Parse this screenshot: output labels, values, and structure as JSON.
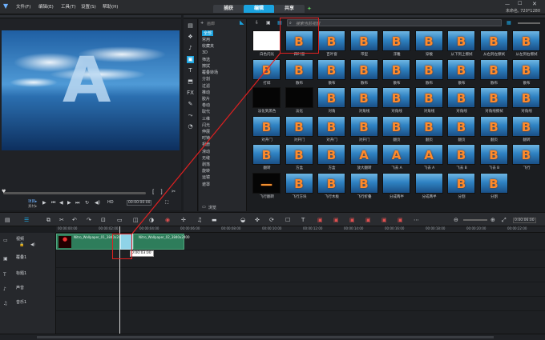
{
  "menu": {
    "items": [
      "文件(F)",
      "编辑(E)",
      "工具(T)",
      "设置(S)",
      "帮助(H)"
    ]
  },
  "modes": {
    "capture": "捕获",
    "edit": "编辑",
    "share": "共享"
  },
  "project": {
    "title": "未命名, 720*1280"
  },
  "preview": {
    "letter": "A",
    "mode_project": "项目▸",
    "mode_clip": "素材▸",
    "timecode": "00:00:00:00"
  },
  "library": {
    "search_placeholder": "搜索当前视图",
    "category_title": "画廊",
    "browse_label": "浏览",
    "categories": [
      "全部",
      "常用",
      "收藏夹",
      "3D",
      "筛选",
      "擦拭",
      "覆叠转场",
      "分割",
      "过滤",
      "推动",
      "胶片",
      "卷动",
      "取代",
      "三维",
      "闪光",
      "伸展",
      "时钟",
      "相册",
      "滑动",
      "无缝",
      "剥落",
      "旋转",
      "运镜",
      "遮罩"
    ],
    "transitions": [
      {
        "label": "白色闪光",
        "style": "white",
        "glyph": ""
      },
      {
        "label": "四叶窗",
        "style": "sky",
        "glyph": "B"
      },
      {
        "label": "百叶窗",
        "style": "sky",
        "glyph": "B"
      },
      {
        "label": "带型",
        "style": "sky",
        "glyph": "B"
      },
      {
        "label": "浮雕",
        "style": "sky",
        "glyph": "B"
      },
      {
        "label": "穿梭",
        "style": "sky",
        "glyph": "B"
      },
      {
        "label": "从下到上擦拭",
        "style": "sky",
        "glyph": "B"
      },
      {
        "label": "从右到左擦拭",
        "style": "sky",
        "glyph": "B"
      },
      {
        "label": "从左到右擦拭",
        "style": "sky",
        "glyph": "B"
      },
      {
        "label": "打碎",
        "style": "sky",
        "glyph": "B"
      },
      {
        "label": "散布",
        "style": "sky",
        "glyph": "B"
      },
      {
        "label": "散布",
        "style": "sky",
        "glyph": "B"
      },
      {
        "label": "散布",
        "style": "sky",
        "glyph": "B"
      },
      {
        "label": "散布",
        "style": "sky",
        "glyph": "B"
      },
      {
        "label": "散布",
        "style": "sky",
        "glyph": "B"
      },
      {
        "label": "散布",
        "style": "sky",
        "glyph": "B"
      },
      {
        "label": "散布",
        "style": "sky",
        "glyph": "B"
      },
      {
        "label": "散布",
        "style": "sky",
        "glyph": "B"
      },
      {
        "label": "淡化到黑色",
        "style": "black",
        "glyph": ""
      },
      {
        "label": "淡化",
        "style": "black",
        "glyph": ""
      },
      {
        "label": "对角",
        "style": "sky",
        "glyph": "B"
      },
      {
        "label": "对角线",
        "style": "sky",
        "glyph": "B"
      },
      {
        "label": "对角线",
        "style": "sky",
        "glyph": "B"
      },
      {
        "label": "对角线",
        "style": "sky",
        "glyph": "B"
      },
      {
        "label": "对角线",
        "style": "sky",
        "glyph": "B"
      },
      {
        "label": "对角线擦拭",
        "style": "sky",
        "glyph": "B"
      },
      {
        "label": "对角线",
        "style": "sky",
        "glyph": "B"
      },
      {
        "label": "对开门",
        "style": "sky",
        "glyph": "B"
      },
      {
        "label": "对开门",
        "style": "sky",
        "glyph": "B"
      },
      {
        "label": "对开门",
        "style": "sky",
        "glyph": "B"
      },
      {
        "label": "对开门",
        "style": "sky",
        "glyph": "B"
      },
      {
        "label": "翻页",
        "style": "sky",
        "glyph": "B"
      },
      {
        "label": "翻页",
        "style": "sky",
        "glyph": "B"
      },
      {
        "label": "翻页",
        "style": "sky",
        "glyph": "B"
      },
      {
        "label": "翻页",
        "style": "sky",
        "glyph": "B"
      },
      {
        "label": "翻转",
        "style": "sky",
        "glyph": "B"
      },
      {
        "label": "翻转",
        "style": "sky",
        "glyph": "B"
      },
      {
        "label": "方盒",
        "style": "sky",
        "glyph": "B"
      },
      {
        "label": "方盒",
        "style": "sky",
        "glyph": "B"
      },
      {
        "label": "放大翻转",
        "style": "sky",
        "glyph": "A"
      },
      {
        "label": "飞去 A",
        "style": "sky",
        "glyph": "A"
      },
      {
        "label": "飞去 A",
        "style": "sky",
        "glyph": "A"
      },
      {
        "label": "飞去 B",
        "style": "sky",
        "glyph": "B"
      },
      {
        "label": "飞去 B",
        "style": "sky",
        "glyph": "B"
      },
      {
        "label": "飞行",
        "style": "sky",
        "glyph": "B"
      },
      {
        "label": "飞行翻转",
        "style": "black",
        "glyph": "—"
      },
      {
        "label": "飞行方块",
        "style": "sky",
        "glyph": "B"
      },
      {
        "label": "飞行木板",
        "style": "sky",
        "glyph": "B"
      },
      {
        "label": "飞行折叠",
        "style": "sky",
        "glyph": "B"
      },
      {
        "label": "分成两半",
        "style": "sky",
        "glyph": ""
      },
      {
        "label": "分成两半",
        "style": "sky",
        "glyph": ""
      },
      {
        "label": "分割",
        "style": "sky",
        "glyph": "B"
      },
      {
        "label": "分割",
        "style": "sky",
        "glyph": "B"
      }
    ]
  },
  "timeline": {
    "ruler_ticks": [
      "00:00:00:00",
      "00:00:02:00",
      "00:00:04:00",
      "00:00:06:00",
      "00:00:08:00",
      "00:00:10:00",
      "00:00:12:00",
      "00:00:14:00",
      "00:00:16:00",
      "00:00:18:00",
      "00:00:20:00",
      "00:00:22:00"
    ],
    "duration": "0:00:06:00",
    "tracks": [
      "视频",
      "覆叠1",
      "标题1",
      "声音",
      "音乐1"
    ],
    "clip1": "Nitro_Wallpaper_01_3840x2400",
    "clip2": "Nitro_Wallpaper_02_3840x2400",
    "tooltip": "0:00:03:00"
  }
}
